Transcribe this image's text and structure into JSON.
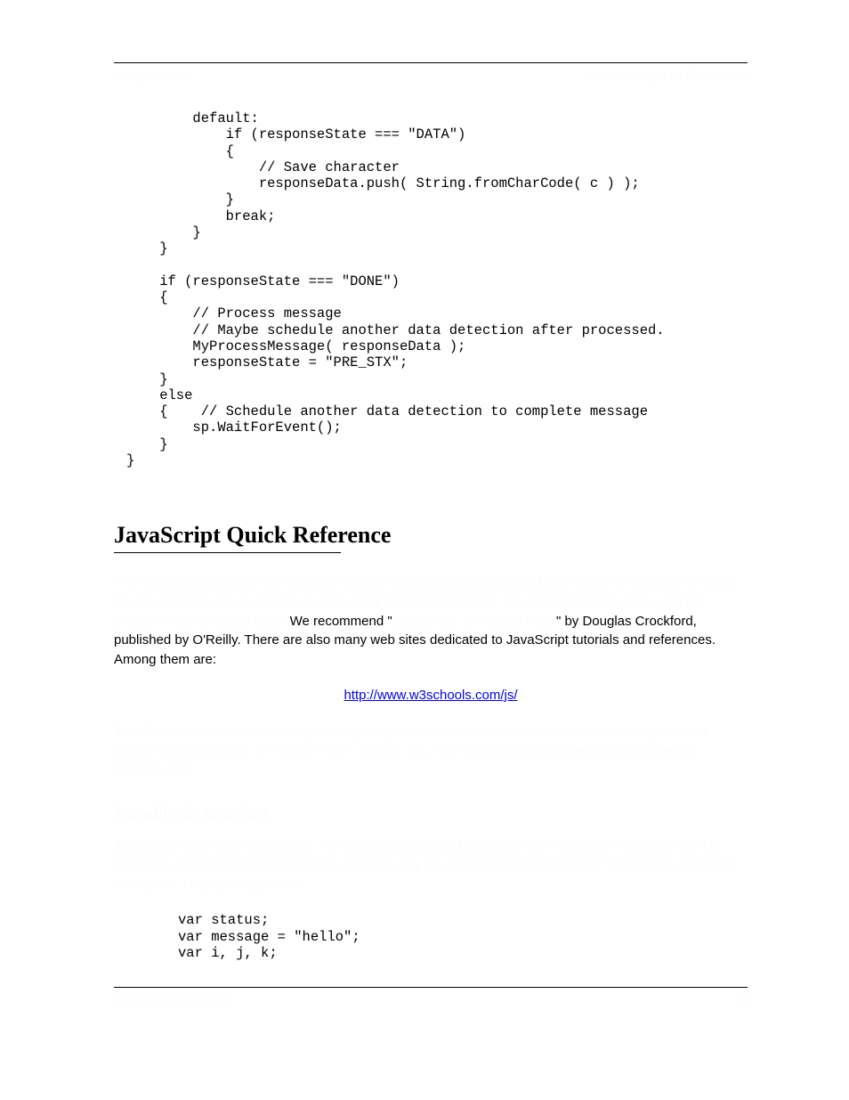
{
  "header": {
    "left": "ScriptBasics",
    "right": "JavaScript Quick Reference"
  },
  "code_block_1": "        default:\n            if (responseState === \"DATA\")\n            {\n                // Save character\n                responseData.push( String.fromCharCode( c ) );\n            }\n            break;\n        }\n    }\n\n    if (responseState === \"DONE\")\n    {\n        // Process message\n        // Maybe schedule another data detection after processed.\n        MyProcessMessage( responseData );\n        responseState = \"PRE_STX\";\n    }\n    else\n    {    // Schedule another data detection to complete message\n        sp.WaitForEvent();\n    }\n}",
  "section": {
    "title": "JavaScript Quick Reference",
    "para1_a": "The information below is not intended to teach JavaScript programming but to act as a reminder for those already familiar with JavaScript or other programming languages. For getting started with JavaScript programming consult a book.",
    "para1_b_plain": "We recommend \"",
    "para1_b_italic": "JavaScript: The Good Parts",
    "para1_c": "\" by Douglas Crockford, published by O'Reilly. There are also many web sites dedicated to JavaScript tutorials and references. Among them are:",
    "link": "http://www.w3schools.com/js/",
    "para2": "JaveScript is an interpretive programming language. It supports much of the structured programming syntax from C, such as \"if\", \"while\", \"for\", \"switch\", etc. The JaveScript language is standardized as ECMAScript.",
    "sub_title": "Variable declarations",
    "sub_para": "JavaScript uses loose data typing. All variables are defined using the \"var\" keyword. A variable may be initialized when declared, and several variables may be declared in one statement. Statements end with a semicolon. Thus you might see:"
  },
  "code_block_2": "var status;\nvar message = \"hello\";\nvar i, j, k;",
  "footer": {
    "left": "Serial Port Scripting",
    "right": "19"
  }
}
